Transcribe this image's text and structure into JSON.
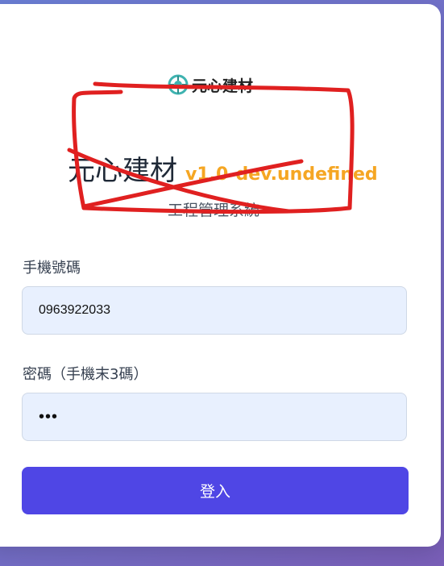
{
  "brand": {
    "logo_text": "元心建材",
    "title": "元心建材",
    "version": "v1.0-dev.undefined",
    "subtitle": "工程管理系統"
  },
  "form": {
    "phone_label": "手機號碼",
    "phone_value": "0963922033",
    "password_label": "密碼（手機末3碼）",
    "password_value": "•••",
    "submit_label": "登入"
  },
  "colors": {
    "accent": "#4f46e5",
    "version": "#f5a623",
    "annotation": "#e02020",
    "input_bg": "#e8f0fe"
  },
  "icons": {
    "logo": "brand-logo-icon"
  }
}
